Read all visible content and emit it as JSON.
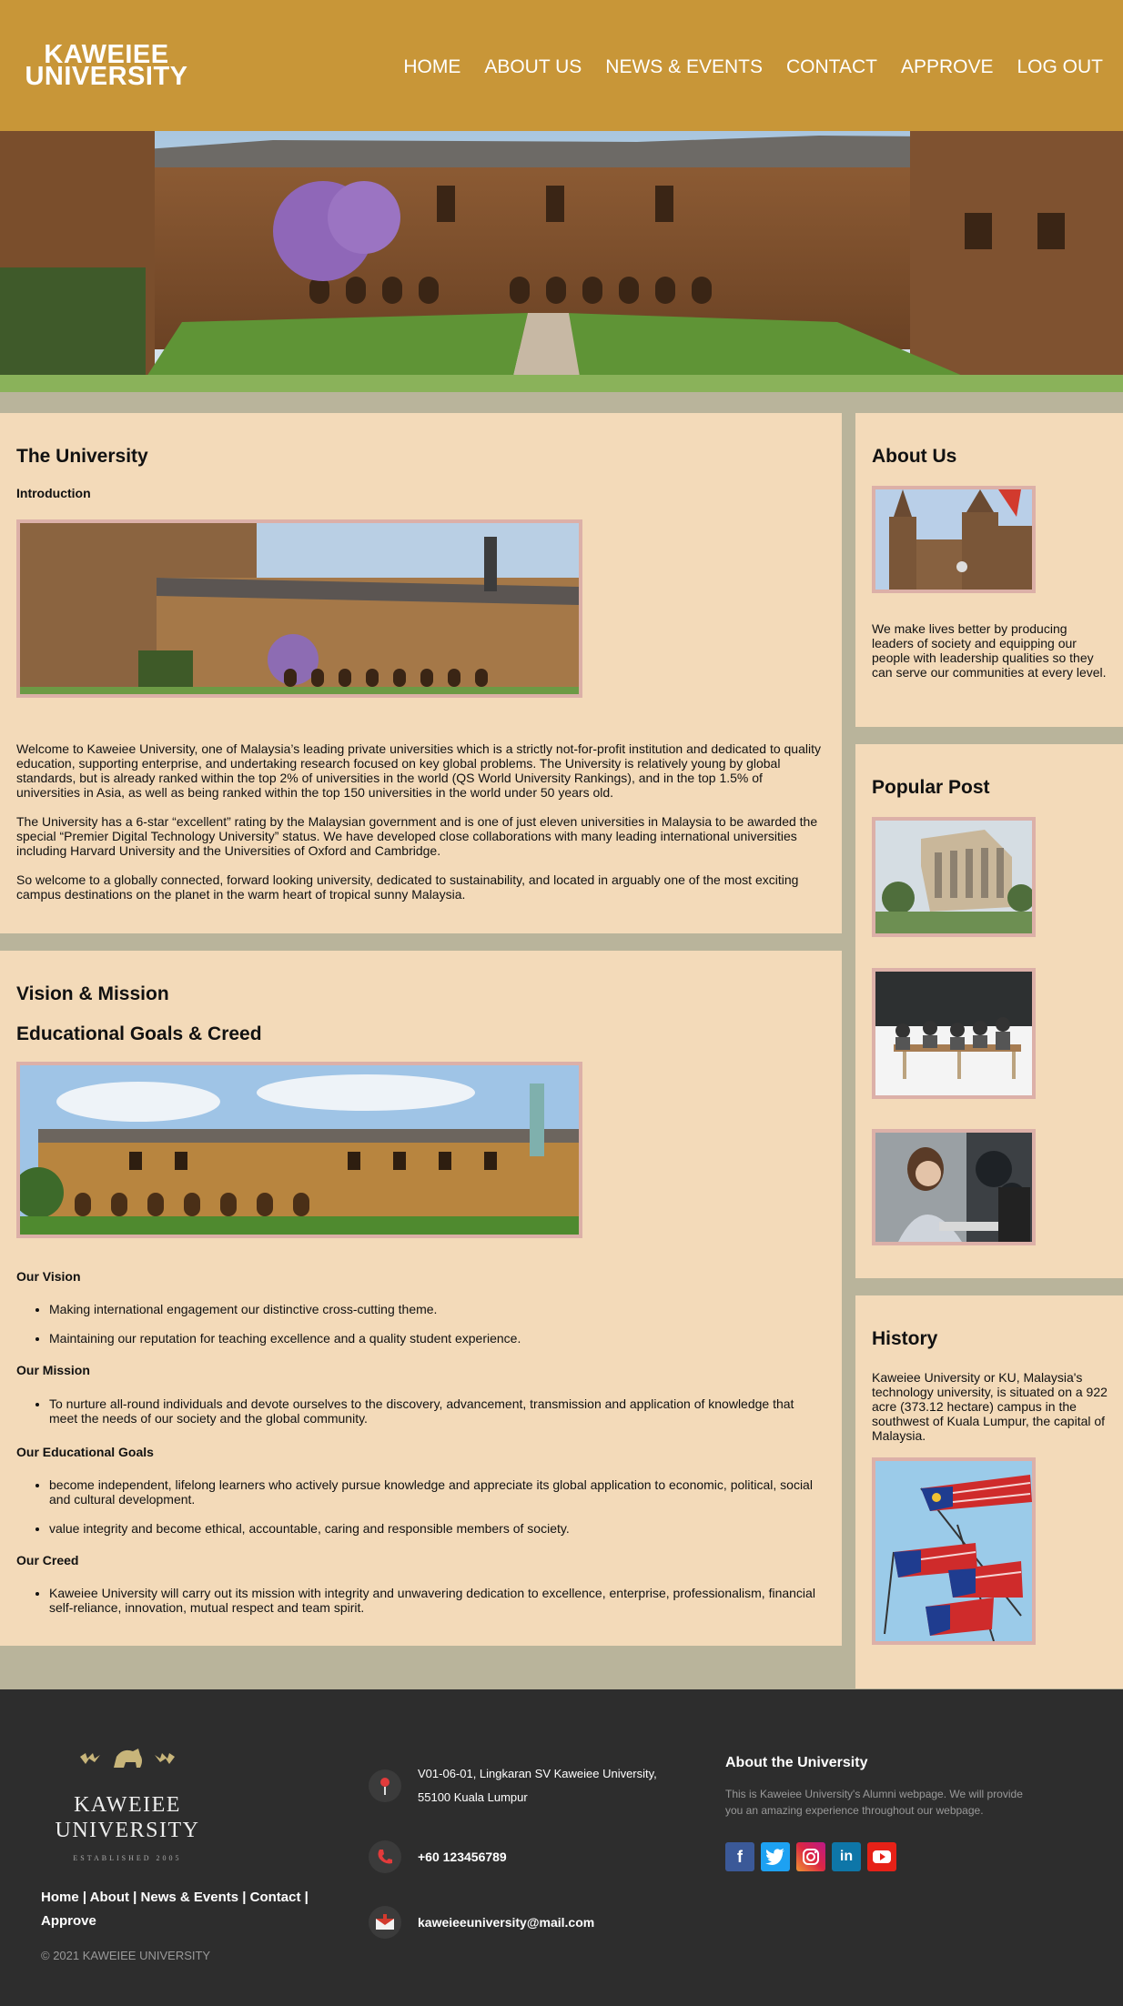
{
  "header": {
    "logo_line1": "KAWEIEE",
    "logo_line2": "UNIVERSITY",
    "nav": [
      "HOME",
      "ABOUT US",
      "NEWS & EVENTS",
      "CONTACT",
      "APPROVE",
      "LOG OUT"
    ]
  },
  "university": {
    "title": "The University",
    "subtitle": "Introduction",
    "paragraphs": [
      "Welcome to Kaweiee University, one of Malaysia’s leading private universities which is a strictly not-for-profit institution and dedicated to quality education, supporting enterprise, and undertaking research focused on key global problems. The University is relatively young by global standards, but is already ranked within the top 2% of universities in the world (QS World University Rankings), and in the top 1.5% of universities in Asia, as well as being ranked within the top 150 universities in the world under 50 years old.",
      "The University has a 6-star “excellent” rating by the Malaysian government and is one of just eleven universities in Malaysia to be awarded the special “Premier Digital Technology University” status. We have developed close collaborations with many leading international universities including Harvard University and the Universities of Oxford and Cambridge.",
      "So welcome to a globally connected, forward looking university, dedicated to sustainability, and located in arguably one of the most exciting campus destinations on the planet in the warm heart of tropical sunny Malaysia."
    ]
  },
  "vision": {
    "title": "Vision & Mission",
    "subtitle": "Educational Goals & Creed",
    "vision_heading": "Our Vision",
    "vision_items": [
      "Making international engagement our distinctive cross-cutting theme.",
      "Maintaining our reputation for teaching excellence and a quality student experience."
    ],
    "mission_heading": "Our Mission",
    "mission_items": [
      "To nurture all-round individuals and devote ourselves to the discovery, advancement, transmission and application of knowledge that meet the needs of our society and the global community."
    ],
    "goals_heading": "Our Educational Goals",
    "goals_items": [
      "become independent, lifelong learners who actively pursue knowledge and appreciate its global application to economic, political, social and cultural development.",
      "value integrity and become ethical, accountable, caring and responsible members of society."
    ],
    "creed_heading": "Our Creed",
    "creed_items": [
      "Kaweiee University will carry out its mission with integrity and unwavering dedication to excellence, enterprise, professionalism, financial self-reliance, innovation, mutual respect and team spirit."
    ]
  },
  "about": {
    "title": "About Us",
    "text": "We make lives better by producing leaders of society and equipping our people with leadership qualities so they can serve our communities at every level."
  },
  "popular": {
    "title": "Popular Post"
  },
  "history": {
    "title": "History",
    "text": "Kaweiee University or KU, Malaysia's technology university, is situated on a 922 acre (373.12 hectare) campus in the southwest of Kuala Lumpur, the capital of Malaysia."
  },
  "footer": {
    "brand_line1": "KAWEIEE",
    "brand_line2": "UNIVERSITY",
    "established": "ESTABLISHED 2005",
    "links": [
      "Home",
      "About",
      "News & Events",
      "Contact",
      "Approve"
    ],
    "copyright": "© 2021 KAWEIEE UNIVERSITY",
    "address_line1": "V01-06-01, Lingkaran SV Kaweiee University,",
    "address_line2": "55100 Kuala Lumpur",
    "phone": "+60 123456789",
    "email": "kaweieeuniversity@mail.com",
    "about_title": "About the University",
    "about_text": "This is Kaweiee University's Alumni webpage. We will provide you an amazing experience throughout our webpage.",
    "socials": [
      "facebook-icon",
      "twitter-icon",
      "instagram-icon",
      "linkedin-icon",
      "youtube-icon"
    ]
  },
  "colors": {
    "header": "#c89638",
    "panel": "#f3dab9",
    "background": "#b9b49b",
    "footer": "#2d2d2d",
    "frame": "#dcb0a8"
  }
}
